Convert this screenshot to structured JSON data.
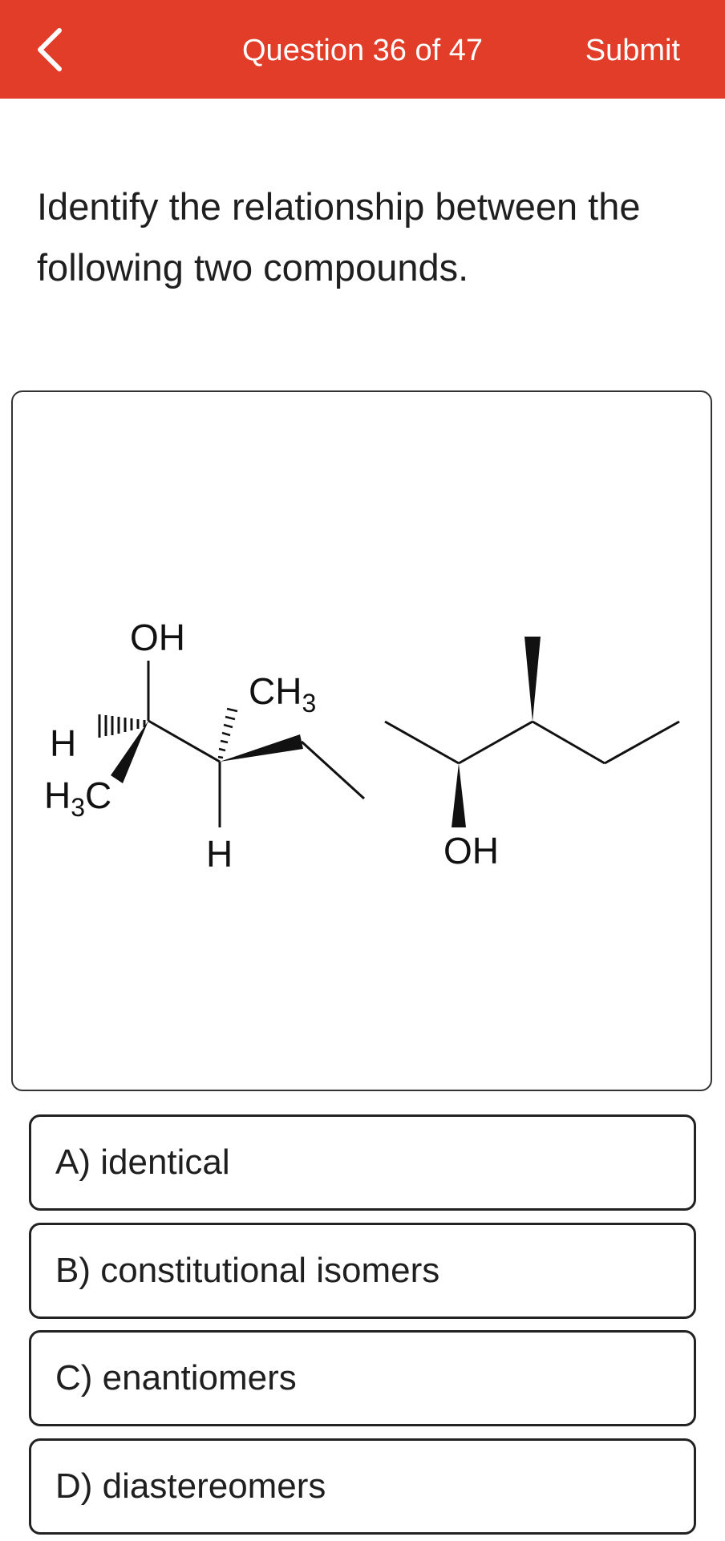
{
  "header": {
    "back_icon": "chevron-left-icon",
    "title": "Question 36 of 47",
    "submit_label": "Submit",
    "background_color": "#e23d28"
  },
  "question": {
    "text": "Identify the relationship between the following two compounds."
  },
  "structures": {
    "left": {
      "oh": "OH",
      "h_left": "H",
      "h3c_h": "H",
      "h3c_sub": "3",
      "h3c_c": "C",
      "ch3_c": "CH",
      "ch3_sub": "3",
      "h_bottom": "H"
    },
    "right": {
      "oh": "OH"
    }
  },
  "options": [
    {
      "label": "A) identical"
    },
    {
      "label": "B) constitutional isomers"
    },
    {
      "label": "C) enantiomers"
    },
    {
      "label": "D) diastereomers"
    }
  ]
}
